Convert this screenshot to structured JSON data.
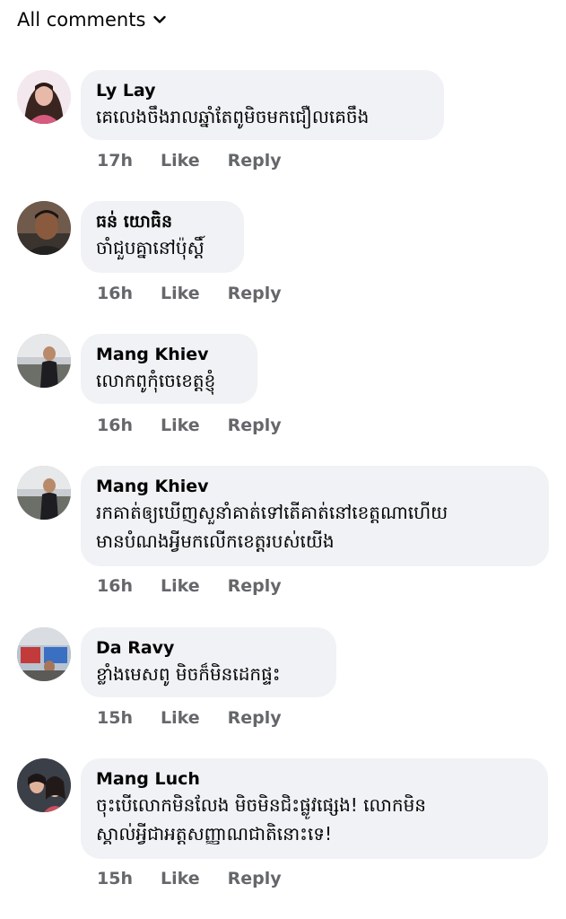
{
  "filter": {
    "label": "All comments",
    "icon": "chevron-down-icon"
  },
  "actions": {
    "like": "Like",
    "reply": "Reply"
  },
  "comments": [
    {
      "author": "Ly Lay",
      "text": "គេលេងចឹងរាលឆ្នាំតែពូមិចមកជឿលគេចឹង",
      "time": "17h"
    },
    {
      "author": "ធន់ យោធិន",
      "text": "ចាំជួបគ្នានៅប៉ុស្ដិ៍",
      "time": "16h"
    },
    {
      "author": "Mang Khiev",
      "text": "លោកពូកុំចេខេត្តខ្ញុំ",
      "time": "16h"
    },
    {
      "author": "Mang Khiev",
      "text": "រកគាត់ឲ្យឃើញសួនាំគាត់ទៅតើគាត់នៅខេត្តណាហើយ",
      "text2": "មានបំណងអ្វីមកលើកខេត្តរបស់យើង",
      "time": "16h"
    },
    {
      "author": "Da Ravy",
      "text": "ខ្លាំងមេសពូ មិចក៏មិនដេកផ្ទះ",
      "time": "15h"
    },
    {
      "author": "Mang Luch",
      "text": "ចុះបើលោកមិនលែង មិចមិនជិះផ្លូវផ្សេង! លោកមិន",
      "text2": "ស្គាល់អ្វីជាអត្តសញ្ញាណជាតិនោះទេ!",
      "time": "15h"
    }
  ]
}
